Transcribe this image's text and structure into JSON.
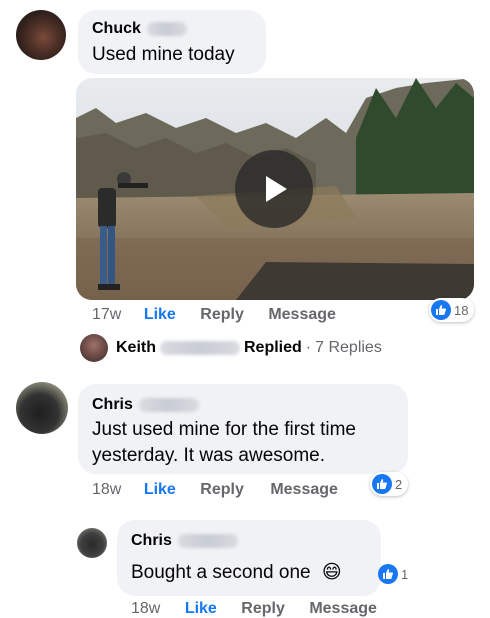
{
  "comments": [
    {
      "author": "Chuck",
      "text": "Used mine today",
      "time": "17w",
      "actions": {
        "like": "Like",
        "reply": "Reply",
        "message": "Message"
      },
      "reactions": "18",
      "replies_summary": {
        "author": "Keith",
        "label": "Replied",
        "sep": "·",
        "count": "7 Replies"
      }
    },
    {
      "author": "Chris",
      "text_line1": "Just used mine for the first time",
      "text_line2": "yesterday. It was awesome.",
      "time": "18w",
      "actions": {
        "like": "Like",
        "reply": "Reply",
        "message": "Message"
      },
      "reactions": "2"
    },
    {
      "author": "Chris",
      "text": "Bought a second one",
      "emoji": "😄",
      "time": "18w",
      "actions": {
        "like": "Like",
        "reply": "Reply",
        "message": "Message"
      },
      "reactions": "1"
    }
  ],
  "icons": {
    "like_reaction": "thumbs-up-icon",
    "video_play": "play-icon"
  },
  "colors": {
    "accent": "#1877f2",
    "bubble": "#f0f2f5",
    "secondary_text": "#65676b"
  }
}
